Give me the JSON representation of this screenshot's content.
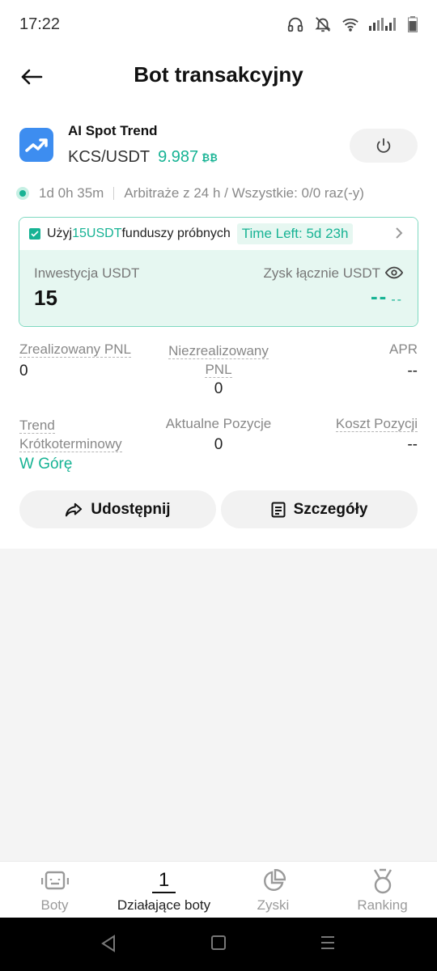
{
  "status_bar": {
    "time": "17:22"
  },
  "header": {
    "title": "Bot transakcyjny"
  },
  "bot": {
    "name": "AI Spot Trend",
    "pair": "KCS/USDT",
    "price": "9.987",
    "price_icon": "₿₿",
    "run_time": "1d 0h 35m",
    "arbitrage_text": "Arbitraże z 24 h / Wszystkie: 0/0 raz(-y)"
  },
  "trial": {
    "prefix": "Użyj",
    "amount": "15USDT",
    "suffix": "funduszy próbnych",
    "time_left": "Time Left: 5d 23h"
  },
  "investment": {
    "label": "Inwestycja USDT",
    "value": "15",
    "profit_label": "Zysk łącznie USDT",
    "profit_value": "--",
    "profit_sub": "--"
  },
  "stats": {
    "realized_label": "Zrealizowany PNL",
    "realized_value": "0",
    "unrealized_label_1": "Niezrealizowany",
    "unrealized_label_2": "PNL",
    "unrealized_value": "0",
    "apr_label": "APR",
    "apr_value": "--",
    "trend_label_1": "Trend",
    "trend_label_2": "Krótkoterminowy",
    "trend_value": "W Górę",
    "positions_label": "Aktualne Pozycje",
    "positions_value": "0",
    "cost_label": "Koszt Pozycji",
    "cost_value": "--"
  },
  "actions": {
    "share": "Udostępnij",
    "details": "Szczegóły"
  },
  "nav": {
    "bots": "Boty",
    "running_count": "1",
    "running": "Działające boty",
    "profits": "Zyski",
    "ranking": "Ranking"
  },
  "colors": {
    "accent": "#17b394",
    "accent_light": "#e6f7f1",
    "bot_icon": "#3d8df0"
  }
}
